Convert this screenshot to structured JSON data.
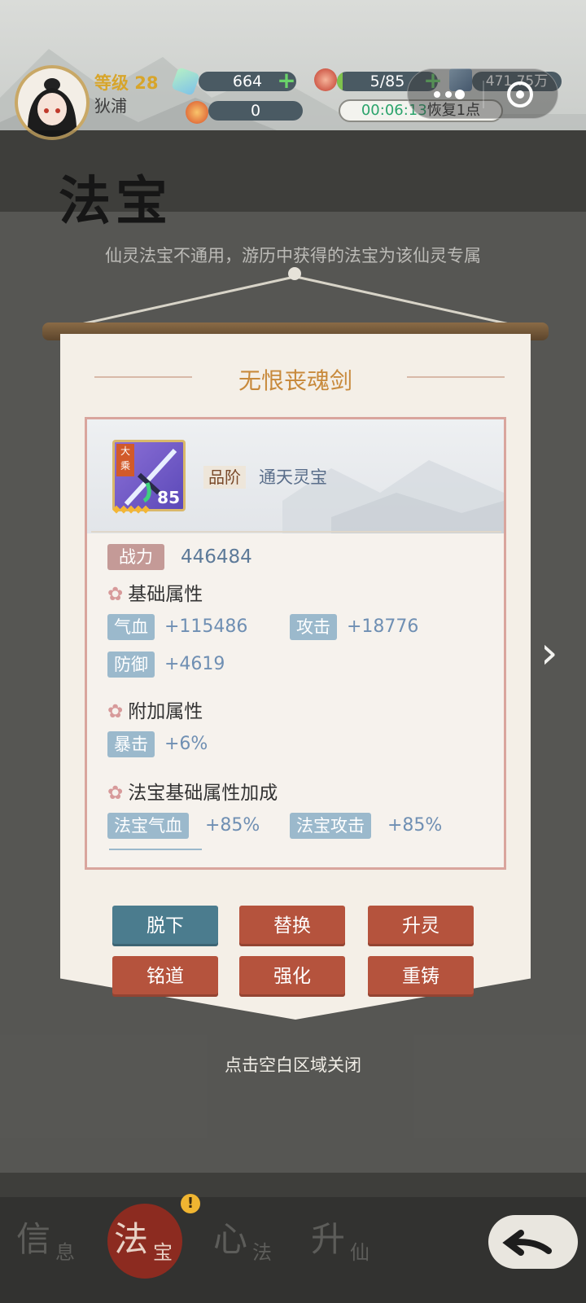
{
  "header": {
    "level_label": "等级 28",
    "player_name": "狄浦",
    "resources": {
      "gem": "664",
      "stamina": "5/85",
      "crystal": "471.75万",
      "orb": "0"
    },
    "recover": {
      "time": "00:06:13",
      "text": "恢复1点"
    }
  },
  "page": {
    "title": "法宝",
    "notice": "仙灵法宝不通用，游历中获得的法宝为该仙灵专属"
  },
  "modal": {
    "title": "无恨丧魂剑",
    "item": {
      "badge": "大乘",
      "level": "85",
      "stars": "◆◆◆◆◆",
      "grade_label": "品阶",
      "grade_value": "通天灵宝"
    },
    "power_label": "战力",
    "power_value": "446484",
    "base_section": "基础属性",
    "base_stats": [
      {
        "label": "气血",
        "value": "+115486"
      },
      {
        "label": "攻击",
        "value": "+18776"
      },
      {
        "label": "防御",
        "value": "+4619"
      }
    ],
    "extra_section": "附加属性",
    "extra_stats": [
      {
        "label": "暴击",
        "value": "+6%"
      }
    ],
    "bonus_section": "法宝基础属性加成",
    "bonus_stats": [
      {
        "label": "法宝气血",
        "value": "+85%"
      },
      {
        "label": "法宝攻击",
        "value": "+85%"
      }
    ],
    "buttons": {
      "unequip": "脱下",
      "replace": "替换",
      "ascend": "升灵",
      "inscribe": "铭道",
      "enhance": "强化",
      "reforge": "重铸"
    },
    "close_hint": "点击空白区域关闭"
  },
  "tabs": [
    {
      "big": "信",
      "small": "息"
    },
    {
      "big": "法",
      "small": "宝"
    },
    {
      "big": "心",
      "small": "法"
    },
    {
      "big": "升",
      "small": "仙"
    }
  ],
  "colors": {
    "accent_gold": "#c88a3c",
    "button_blue": "#4b7c8e",
    "button_red": "#b5533d",
    "stat_tag": "#9bb9cc"
  }
}
